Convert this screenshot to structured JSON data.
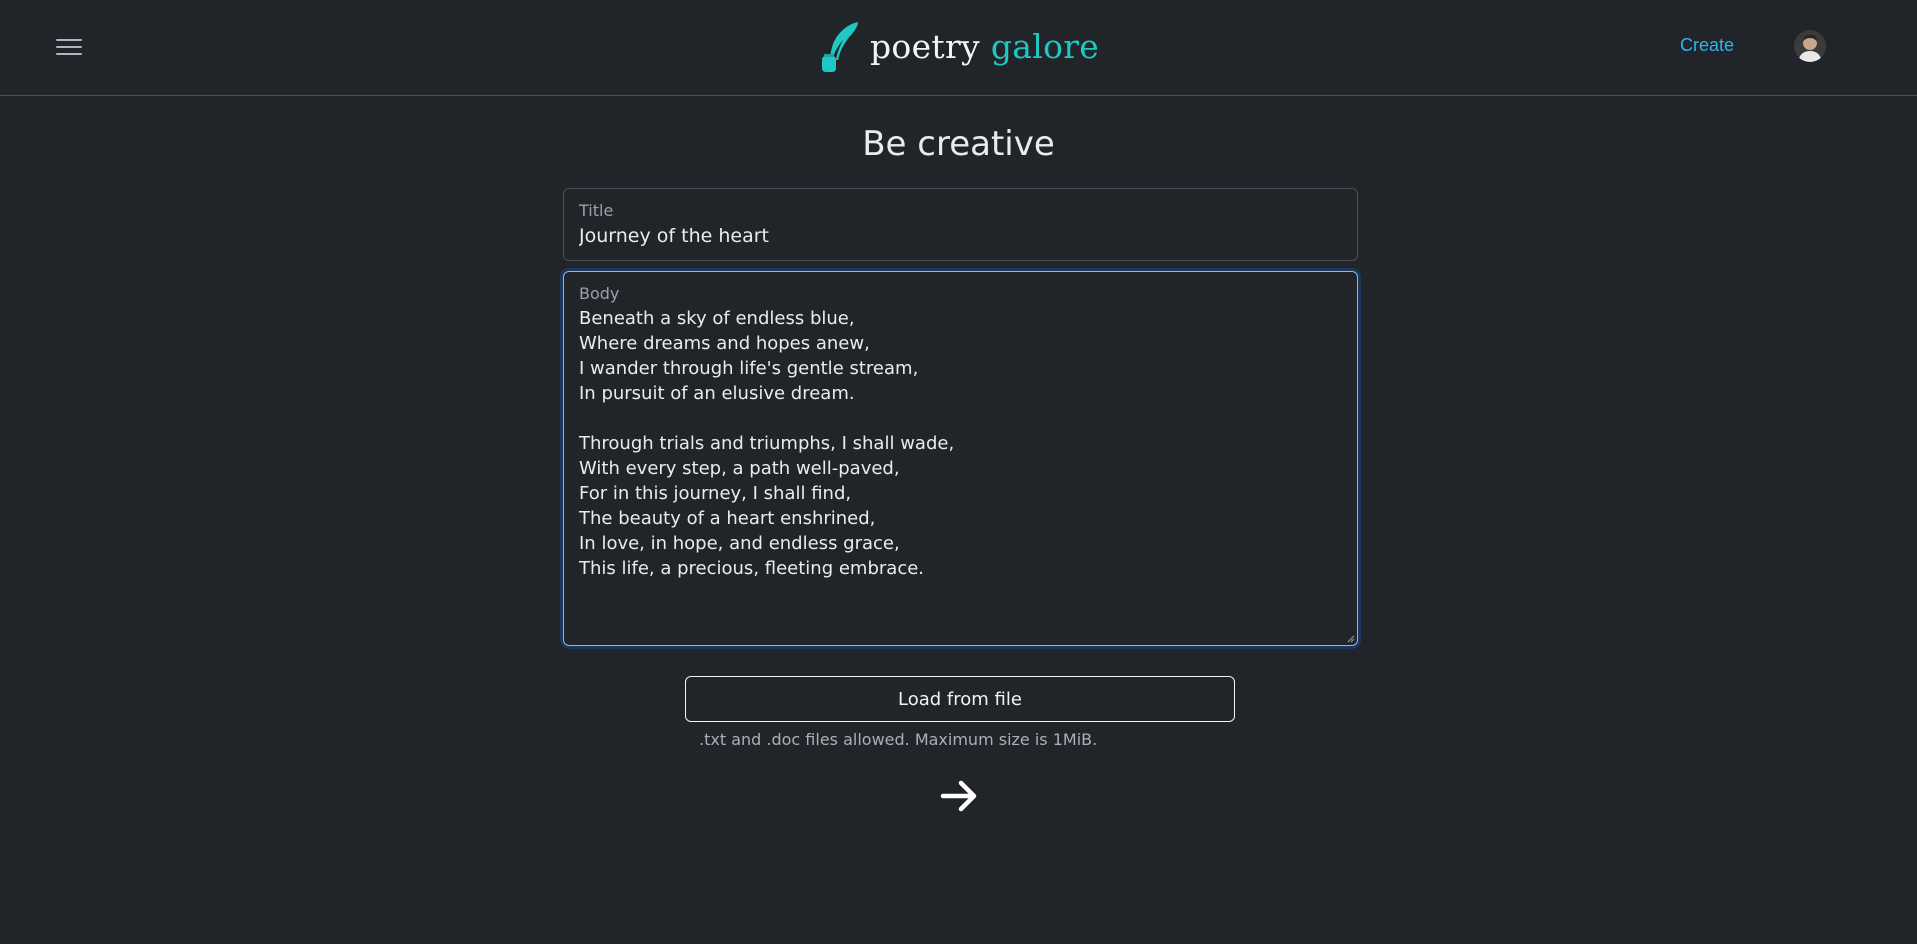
{
  "header": {
    "brand_word1": "poetry",
    "brand_word2": "galore",
    "create_label": "Create",
    "icons": [
      "menu-icon",
      "quill-icon",
      "avatar"
    ]
  },
  "main": {
    "heading": "Be creative",
    "title_field": {
      "label": "Title",
      "value": "Journey of the heart"
    },
    "body_field": {
      "label": "Body",
      "value": "Beneath a sky of endless blue,\nWhere dreams and hopes anew,\nI wander through life's gentle stream,\nIn pursuit of an elusive dream.\n\nThrough trials and triumphs, I shall wade,\nWith every step, a path well-paved,\nFor in this journey, I shall find,\nThe beauty of a heart enshrined,\nIn love, in hope, and endless grace,\nThis life, a precious, fleeting embrace."
    },
    "load_button_label": "Load from file",
    "file_help": ".txt and .doc files allowed. Maximum size is 1MiB.",
    "next_icon": "arrow-right-icon"
  },
  "colors": {
    "background": "#212529",
    "brand_accent": "#1fc8c2",
    "link": "#2fb4f0",
    "focus_border": "#86b7fe"
  }
}
